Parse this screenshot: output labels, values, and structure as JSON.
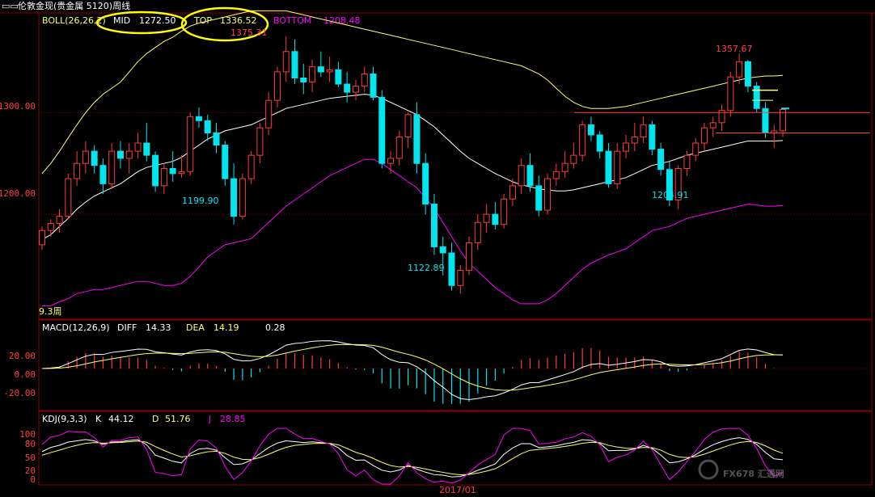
{
  "window": {
    "title": "伦敦金现(贵金属 5120)周线"
  },
  "indicators": {
    "boll": {
      "name": "BOLL(26,26,2)",
      "mid_label": "MID",
      "mid_value": "1272.50",
      "top_label": "TOP",
      "top_value": "1336.52",
      "bottom_label": "BOTTOM",
      "bottom_value": "1208.48"
    },
    "macd": {
      "name": "MACD(12,26,9)",
      "diff_label": "DIFF",
      "diff_value": "14.33",
      "dea_label": "DEA",
      "dea_value": "14.19",
      "macd_value": "0.28"
    },
    "kdj": {
      "name": "KDJ(9,3,3)",
      "k_label": "K",
      "k_value": "44.12",
      "d_label": "D",
      "d_value": "51.76",
      "j_label": "J",
      "j_value": "28.85"
    }
  },
  "price_axis": [
    "1300.00",
    "1200.00"
  ],
  "macd_axis": [
    "20.00",
    "0.00",
    "-20.00"
  ],
  "kdj_axis": [
    "100",
    "80",
    "50",
    "20",
    "0"
  ],
  "x_axis_label": "2017/01",
  "price_annotations": {
    "high_1": "1375.31",
    "low_1": "1199.90",
    "low_2": "1122.89",
    "high_2": "1357.67",
    "low_3": "1204.91"
  },
  "corner_label": "9.3周",
  "watermark": "FX678 汇通网",
  "colors": {
    "up": "#ff3b3b",
    "down": "#00e5ee",
    "mid": "#ffffff",
    "upper": "#ffff66",
    "lower": "#ff00ff",
    "grid": "#8b0000",
    "axis_text": "#ff4040",
    "highlight": "#ffff00"
  },
  "chart_data": {
    "type": "candlestick",
    "title": "伦敦金现(贵金属 5120)周线",
    "ylim": [
      1100,
      1390
    ],
    "candles": [
      [
        1170,
        1188,
        1165,
        1184
      ],
      [
        1184,
        1195,
        1178,
        1191
      ],
      [
        1191,
        1205,
        1182,
        1198
      ],
      [
        1198,
        1240,
        1195,
        1235
      ],
      [
        1235,
        1262,
        1228,
        1250
      ],
      [
        1250,
        1272,
        1240,
        1262
      ],
      [
        1262,
        1268,
        1240,
        1248
      ],
      [
        1248,
        1255,
        1220,
        1230
      ],
      [
        1230,
        1270,
        1225,
        1262
      ],
      [
        1262,
        1272,
        1245,
        1255
      ],
      [
        1255,
        1270,
        1240,
        1262
      ],
      [
        1262,
        1280,
        1255,
        1270
      ],
      [
        1270,
        1290,
        1252,
        1258
      ],
      [
        1258,
        1262,
        1222,
        1228
      ],
      [
        1228,
        1250,
        1220,
        1245
      ],
      [
        1245,
        1262,
        1232,
        1240
      ],
      [
        1240,
        1258,
        1236,
        1242
      ],
      [
        1242,
        1300,
        1238,
        1296
      ],
      [
        1296,
        1305,
        1285,
        1292
      ],
      [
        1292,
        1298,
        1272,
        1280
      ],
      [
        1280,
        1290,
        1260,
        1268
      ],
      [
        1268,
        1272,
        1228,
        1235
      ],
      [
        1235,
        1250,
        1190,
        1198
      ],
      [
        1198,
        1240,
        1195,
        1235
      ],
      [
        1235,
        1262,
        1230,
        1258
      ],
      [
        1258,
        1290,
        1250,
        1285
      ],
      [
        1285,
        1320,
        1278,
        1312
      ],
      [
        1312,
        1345,
        1305,
        1340
      ],
      [
        1340,
        1375,
        1330,
        1360
      ],
      [
        1360,
        1372,
        1328,
        1334
      ],
      [
        1334,
        1348,
        1318,
        1330
      ],
      [
        1330,
        1352,
        1320,
        1345
      ],
      [
        1345,
        1360,
        1335,
        1340
      ],
      [
        1340,
        1355,
        1330,
        1342
      ],
      [
        1342,
        1350,
        1325,
        1328
      ],
      [
        1328,
        1340,
        1310,
        1320
      ],
      [
        1320,
        1332,
        1312,
        1326
      ],
      [
        1326,
        1345,
        1320,
        1338
      ],
      [
        1338,
        1345,
        1312,
        1315
      ],
      [
        1315,
        1322,
        1245,
        1250
      ],
      [
        1250,
        1262,
        1240,
        1255
      ],
      [
        1255,
        1282,
        1248,
        1276
      ],
      [
        1276,
        1300,
        1265,
        1298
      ],
      [
        1298,
        1310,
        1240,
        1250
      ],
      [
        1250,
        1260,
        1200,
        1210
      ],
      [
        1210,
        1220,
        1160,
        1168
      ],
      [
        1168,
        1178,
        1140,
        1162
      ],
      [
        1162,
        1172,
        1125,
        1130
      ],
      [
        1130,
        1150,
        1122,
        1145
      ],
      [
        1145,
        1178,
        1140,
        1172
      ],
      [
        1172,
        1200,
        1165,
        1192
      ],
      [
        1192,
        1210,
        1182,
        1200
      ],
      [
        1200,
        1212,
        1185,
        1190
      ],
      [
        1190,
        1220,
        1186,
        1215
      ],
      [
        1215,
        1235,
        1208,
        1228
      ],
      [
        1228,
        1255,
        1220,
        1248
      ],
      [
        1248,
        1260,
        1222,
        1228
      ],
      [
        1228,
        1238,
        1198,
        1204
      ],
      [
        1204,
        1240,
        1200,
        1235
      ],
      [
        1235,
        1250,
        1228,
        1242
      ],
      [
        1242,
        1262,
        1236,
        1250
      ],
      [
        1250,
        1270,
        1245,
        1258
      ],
      [
        1258,
        1292,
        1252,
        1288
      ],
      [
        1288,
        1296,
        1272,
        1278
      ],
      [
        1278,
        1282,
        1255,
        1262
      ],
      [
        1262,
        1270,
        1226,
        1230
      ],
      [
        1230,
        1270,
        1225,
        1262
      ],
      [
        1262,
        1278,
        1255,
        1270
      ],
      [
        1270,
        1290,
        1262,
        1276
      ],
      [
        1276,
        1296,
        1270,
        1288
      ],
      [
        1288,
        1292,
        1258,
        1264
      ],
      [
        1264,
        1270,
        1238,
        1244
      ],
      [
        1244,
        1252,
        1208,
        1214
      ],
      [
        1214,
        1248,
        1205,
        1245
      ],
      [
        1245,
        1262,
        1238,
        1258
      ],
      [
        1258,
        1275,
        1252,
        1270
      ],
      [
        1270,
        1290,
        1262,
        1285
      ],
      [
        1285,
        1296,
        1276,
        1290
      ],
      [
        1290,
        1308,
        1282,
        1302
      ],
      [
        1302,
        1340,
        1296,
        1335
      ],
      [
        1335,
        1358,
        1328,
        1350
      ],
      [
        1350,
        1352,
        1320,
        1326
      ],
      [
        1326,
        1330,
        1300,
        1304
      ],
      [
        1304,
        1310,
        1275,
        1280
      ],
      [
        1280,
        1288,
        1265,
        1282
      ],
      [
        1282,
        1305,
        1276,
        1303
      ]
    ],
    "bands": {
      "mid": [
        1175,
        1180,
        1188,
        1196,
        1205,
        1212,
        1218,
        1222,
        1226,
        1230,
        1236,
        1242,
        1246,
        1248,
        1250,
        1252,
        1256,
        1262,
        1268,
        1274,
        1278,
        1282,
        1284,
        1286,
        1288,
        1292,
        1296,
        1300,
        1304,
        1306,
        1308,
        1310,
        1312,
        1314,
        1315,
        1316,
        1317,
        1318,
        1317,
        1314,
        1310,
        1306,
        1302,
        1298,
        1292,
        1286,
        1278,
        1270,
        1262,
        1255,
        1250,
        1245,
        1240,
        1236,
        1232,
        1229,
        1227,
        1225,
        1224,
        1223,
        1223,
        1224,
        1226,
        1228,
        1230,
        1232,
        1234,
        1236,
        1240,
        1244,
        1248,
        1250,
        1252,
        1255,
        1258,
        1260,
        1262,
        1264,
        1266,
        1268,
        1270,
        1272,
        1272,
        1272,
        1272,
        1272.5
      ],
      "upper": [
        1240,
        1250,
        1262,
        1275,
        1288,
        1300,
        1310,
        1318,
        1324,
        1330,
        1340,
        1350,
        1358,
        1364,
        1370,
        1374,
        1380,
        1385,
        1388,
        1390,
        1392,
        1394,
        1396,
        1398,
        1400,
        1400,
        1400,
        1400,
        1400,
        1398,
        1396,
        1394,
        1392,
        1390,
        1388,
        1386,
        1384,
        1382,
        1380,
        1378,
        1376,
        1374,
        1372,
        1370,
        1368,
        1366,
        1364,
        1362,
        1360,
        1358,
        1356,
        1354,
        1352,
        1350,
        1348,
        1346,
        1342,
        1338,
        1332,
        1324,
        1316,
        1310,
        1306,
        1304,
        1304,
        1304,
        1305,
        1306,
        1308,
        1310,
        1312,
        1314,
        1316,
        1318,
        1320,
        1322,
        1324,
        1326,
        1328,
        1330,
        1332,
        1334,
        1335,
        1336,
        1336,
        1336.5
      ],
      "lower": [
        1110,
        1110,
        1114,
        1117,
        1122,
        1124,
        1126,
        1126,
        1128,
        1130,
        1132,
        1134,
        1134,
        1132,
        1130,
        1130,
        1132,
        1139,
        1148,
        1158,
        1164,
        1170,
        1172,
        1174,
        1176,
        1184,
        1192,
        1200,
        1208,
        1214,
        1220,
        1226,
        1232,
        1238,
        1242,
        1246,
        1250,
        1254,
        1254,
        1250,
        1244,
        1238,
        1232,
        1226,
        1216,
        1206,
        1192,
        1178,
        1164,
        1152,
        1144,
        1136,
        1128,
        1122,
        1116,
        1112,
        1112,
        1112,
        1116,
        1122,
        1130,
        1138,
        1146,
        1152,
        1156,
        1160,
        1163,
        1166,
        1172,
        1178,
        1184,
        1186,
        1188,
        1192,
        1196,
        1198,
        1200,
        1202,
        1204,
        1206,
        1208,
        1210,
        1209,
        1208,
        1208,
        1208.5
      ]
    }
  }
}
